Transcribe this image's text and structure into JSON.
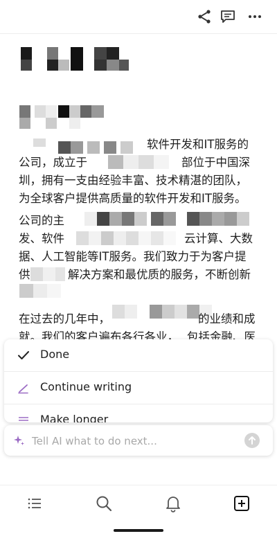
{
  "toolbar": {
    "icons": [
      "share-icon",
      "comment-icon",
      "more-icon"
    ]
  },
  "document": {
    "lines": [
      "软件开发和IT服务的",
      "公司，成立于",
      "部位于中国深",
      "圳，拥有一支由经验丰富、技术精湛的团队，",
      "为全球客户提供高质量的软件开发和IT服务。",
      "公司的主",
      "发、软件",
      "云计算、大数",
      "据、人工智能等IT服务。我们致力于为客户提",
      "供",
      "解决方案和最优质的服务，不断创新",
      "在过去的几年中，",
      "的业绩和成",
      "就。我们的客户遍布各行各业，",
      "包括金融、医"
    ]
  },
  "ai_menu": {
    "items": [
      {
        "label": "Done",
        "icon": "check-icon"
      },
      {
        "label": "Continue writing",
        "icon": "pencil-icon"
      },
      {
        "label": "Make longer",
        "icon": "lines-icon"
      }
    ],
    "accent": "#9b6bc4"
  },
  "ai_input": {
    "placeholder": "Tell AI what to do next...",
    "value": ""
  },
  "bottom_nav": {
    "items": [
      "list-icon",
      "search-icon",
      "bell-icon",
      "new-page-icon"
    ]
  }
}
